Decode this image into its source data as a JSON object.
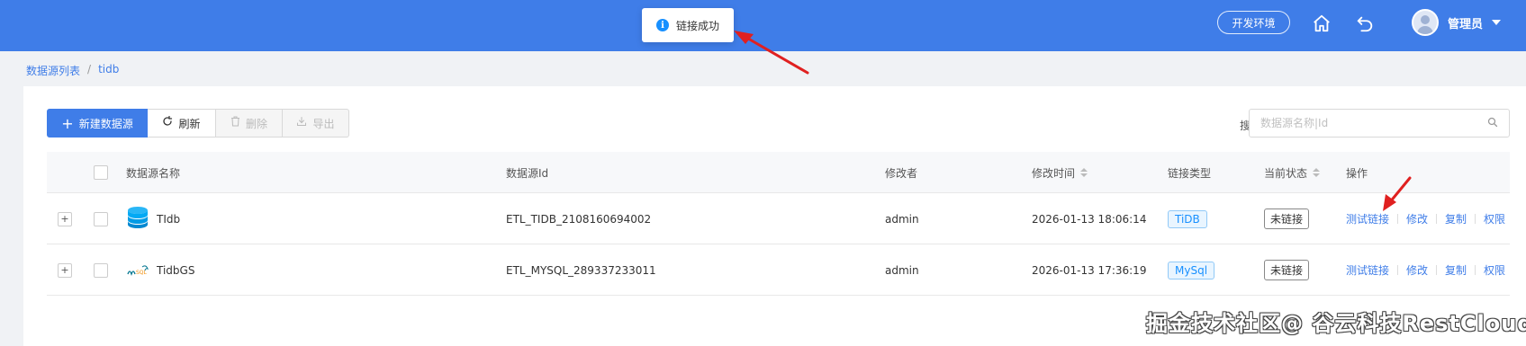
{
  "topbar": {
    "env_label": "开发环境",
    "user_name": "管理员",
    "brand_color": "#3f7de8",
    "icons": [
      "home-icon",
      "back-icon",
      "avatar-icon",
      "chevron-down-icon"
    ]
  },
  "toast": {
    "message": "链接成功",
    "icon": "info-icon"
  },
  "breadcrumb": {
    "items": [
      "数据源列表",
      "tidb"
    ],
    "separator": "/"
  },
  "toolbar": {
    "new_label": "新建数据源",
    "refresh_label": "刷新",
    "delete_label": "删除",
    "export_label": "导出"
  },
  "search": {
    "label": "搜索:",
    "placeholder": "数据源名称|Id",
    "value": ""
  },
  "table": {
    "columns": [
      "数据源名称",
      "数据源Id",
      "修改者",
      "修改时间",
      "链接类型",
      "当前状态",
      "操作"
    ],
    "rows": [
      {
        "name": "TIdb",
        "icon": "database-icon",
        "id": "ETL_TIDB_2108160694002",
        "modifier": "admin",
        "modified_time": "2026-01-13 18:06:14",
        "type": "TiDB",
        "status": "未链接",
        "actions": [
          "测试链接",
          "修改",
          "复制",
          "权限"
        ]
      },
      {
        "name": "TidbGS",
        "icon": "mysql-logo-icon",
        "id": "ETL_MYSQL_289337233011",
        "modifier": "admin",
        "modified_time": "2026-01-13 17:36:19",
        "type": "MySql",
        "status": "未链接",
        "actions": [
          "测试链接",
          "修改",
          "复制",
          "权限"
        ]
      }
    ]
  },
  "watermark": "掘金技术社区@ 谷云科技RestCloud"
}
